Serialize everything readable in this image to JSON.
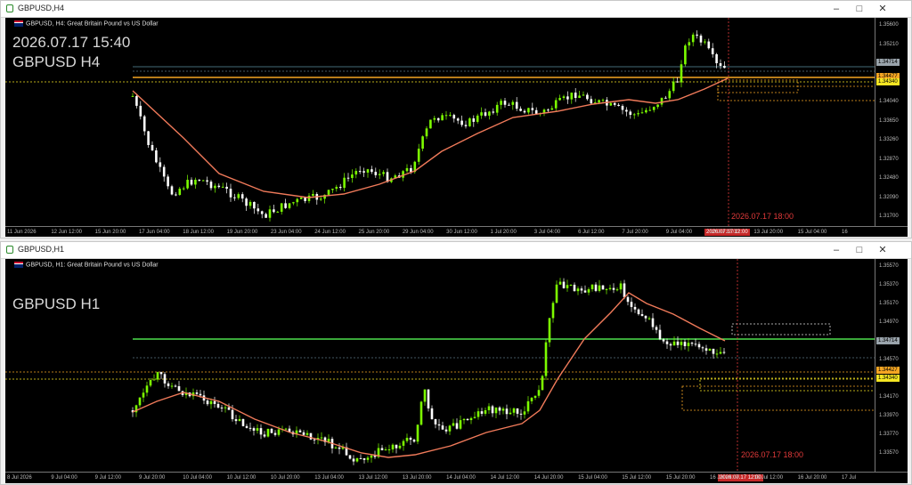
{
  "windows": [
    {
      "title": "GBPUSD,H4",
      "header": "GBPUSD, H4:  Great Britain Pound vs US Dollar",
      "caption_lines": [
        "2026.07.17 15:40",
        "GBPUSD H4"
      ],
      "price_labels": [
        "1.35600",
        "1.35210",
        "1.34820",
        "1.34430",
        "1.34040",
        "1.33650",
        "1.33260",
        "1.32870",
        "1.32480",
        "1.32090",
        "1.31700"
      ],
      "time_labels": [
        "11 Jun 2026",
        "12 Jun 12:00",
        "15 Jun 20:00",
        "17 Jun 04:00",
        "18 Jun 12:00",
        "19 Jun 20:00",
        "23 Jun 04:00",
        "24 Jun 12:00",
        "25 Jun 20:00",
        "29 Jun 04:00",
        "30 Jun 12:00",
        "1 Jul 20:00",
        "3 Jul 04:00",
        "6 Jul 12:00",
        "7 Jul 20:00",
        "9 Jul 04:00",
        "10 Jul 12:00",
        "13 Jul 20:00",
        "15 Jul 04:00",
        "16"
      ],
      "cursor_time_tag": "2026.07.17 12:00",
      "vline_label": "2026.07.17 18:00",
      "price_tags": [
        {
          "text": "1.34714",
          "color": "#9aa4ac",
          "text_color": "#000000"
        },
        {
          "text": "1.34477",
          "color": "#f5a623",
          "text_color": "#000000"
        },
        {
          "text": "1.34340",
          "color": "#f5e623",
          "text_color": "#000000"
        }
      ]
    },
    {
      "title": "GBPUSD,H1",
      "header": "GBPUSD, H1:  Great Britain Pound vs US Dollar",
      "caption_lines": [
        "GBPUSD H1"
      ],
      "price_labels": [
        "1.35570",
        "1.35370",
        "1.35170",
        "1.34970",
        "1.34770",
        "1.34570",
        "1.34370",
        "1.34170",
        "1.33970",
        "1.33770",
        "1.33570"
      ],
      "time_labels": [
        "8 Jul 2026",
        "9 Jul 04:00",
        "9 Jul 12:00",
        "9 Jul 20:00",
        "10 Jul 04:00",
        "10 Jul 12:00",
        "10 Jul 20:00",
        "13 Jul 04:00",
        "13 Jul 12:00",
        "13 Jul 20:00",
        "14 Jul 04:00",
        "14 Jul 12:00",
        "14 Jul 20:00",
        "15 Jul 04:00",
        "15 Jul 12:00",
        "15 Jul 20:00",
        "16 Jul 04:00",
        "16 Jul 12:00",
        "16 Jul 20:00",
        "17 Jul"
      ],
      "cursor_time_tag": "2026.07.17 12:00",
      "vline_label": "2026.07.17 18:00",
      "price_tags": [
        {
          "text": "1.34714",
          "color": "#9aa4ac",
          "text_color": "#000000"
        },
        {
          "text": "1.34427",
          "color": "#f5a623",
          "text_color": "#000000"
        },
        {
          "text": "1.34340",
          "color": "#f5e623",
          "text_color": "#000000"
        }
      ]
    }
  ],
  "colors": {
    "bull_candle": "#7cfc00",
    "bear_candle": "#ffffff",
    "moving_average": "#f07a5a",
    "vertical_line": "#e23a3a",
    "horizontal_green": "#4ee04e",
    "horizontal_orange": "#f5a623",
    "horizontal_yellow": "#f5e623"
  },
  "icons": {
    "window_icon": "chart-window-icon",
    "minimize": "minimize-icon",
    "maximize": "maximize-icon",
    "close": "close-icon"
  }
}
